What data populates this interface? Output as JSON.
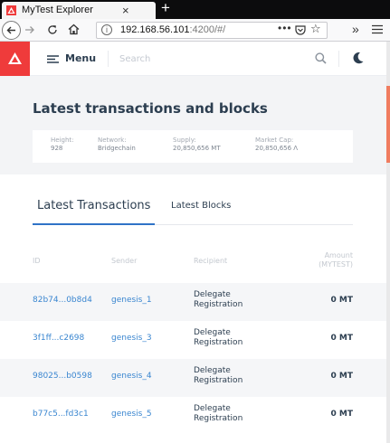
{
  "browser": {
    "tab_title": "MyTest Explorer",
    "tab_close": "×",
    "new_tab": "+",
    "url_host": "192.168.56.101",
    "url_rest": ":4200/#/",
    "url_more": "•••",
    "overflow": "»"
  },
  "header": {
    "menu_label": "Menu",
    "search_placeholder": "Search",
    "accent_color": "#ef3b3b"
  },
  "page": {
    "title": "Latest transactions and blocks",
    "stats": [
      {
        "label": "Height:",
        "value": "928"
      },
      {
        "label": "Network:",
        "value": "Bridgechain"
      },
      {
        "label": "Supply:",
        "value": "20,850,656 MT"
      },
      {
        "label": "Market Cap:",
        "value": "20,850,656 Ʌ"
      }
    ],
    "tabs": {
      "active": "Latest Transactions",
      "inactive": "Latest Blocks"
    },
    "table": {
      "headers": {
        "id": "ID",
        "sender": "Sender",
        "recipient": "Recipient",
        "amount_line1": "Amount",
        "amount_line2": "(MYTEST)"
      },
      "rows": [
        {
          "id": "82b74...0b8d4",
          "sender": "genesis_1",
          "recipient_line1": "Delegate",
          "recipient_line2": "Registration",
          "amount": "0 MT"
        },
        {
          "id": "3f1ff...c2698",
          "sender": "genesis_3",
          "recipient_line1": "Delegate",
          "recipient_line2": "Registration",
          "amount": "0 MT"
        },
        {
          "id": "98025...b0598",
          "sender": "genesis_4",
          "recipient_line1": "Delegate",
          "recipient_line2": "Registration",
          "amount": "0 MT"
        },
        {
          "id": "b77c5...fd3c1",
          "sender": "genesis_5",
          "recipient_line1": "Delegate",
          "recipient_line2": "Registration",
          "amount": "0 MT"
        }
      ]
    }
  }
}
